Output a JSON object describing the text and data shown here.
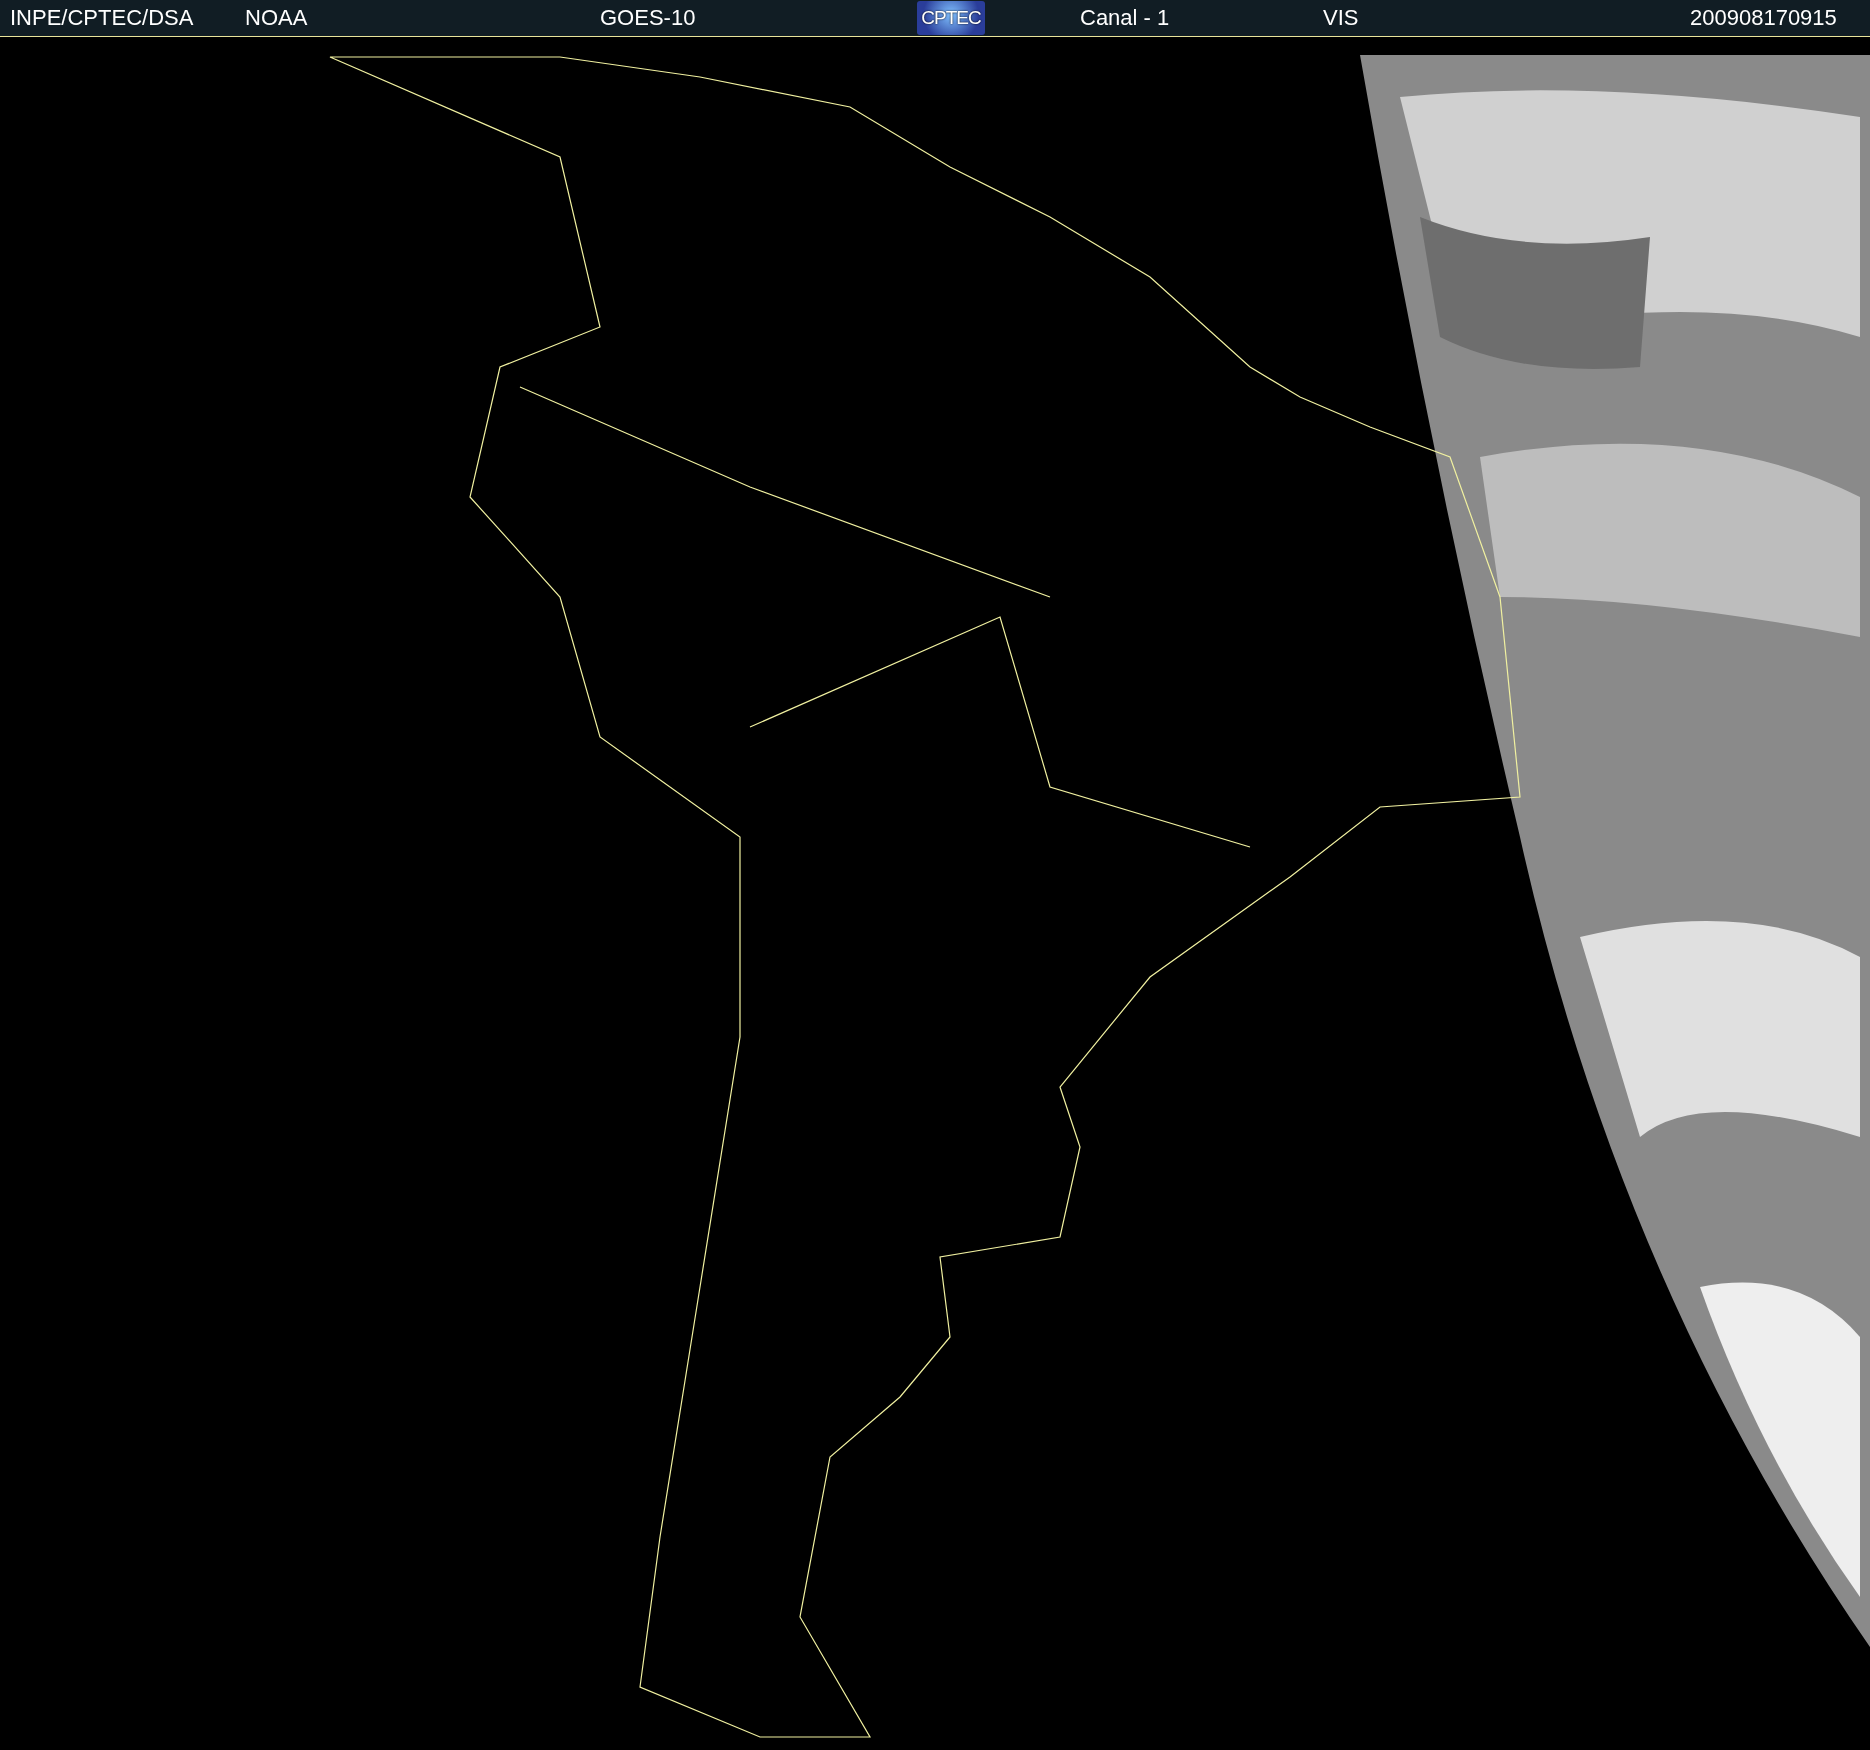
{
  "header": {
    "items": [
      {
        "kind": "text",
        "text": "INPE/CPTEC/DSA"
      },
      {
        "kind": "text",
        "text": "NOAA"
      },
      {
        "kind": "text",
        "text": "GOES-10"
      },
      {
        "kind": "logo",
        "text": "CPTEC"
      },
      {
        "kind": "text",
        "text": "Canal - 1"
      },
      {
        "kind": "text",
        "text": "VIS"
      },
      {
        "kind": "text",
        "text": "200908170915"
      }
    ]
  }
}
